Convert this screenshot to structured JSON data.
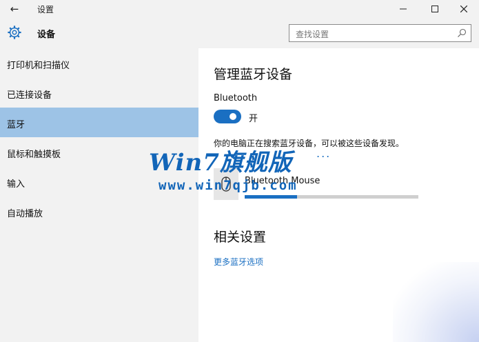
{
  "titlebar": {
    "title": "设置",
    "back_icon": "back-arrow-icon",
    "minimize_icon": "minimize-icon",
    "maximize_icon": "maximize-icon",
    "close_icon": "close-icon"
  },
  "header": {
    "icon": "gear-icon",
    "title": "设备",
    "search_placeholder": "查找设置",
    "search_icon": "search-icon"
  },
  "sidebar": {
    "items": [
      {
        "label": "打印机和扫描仪",
        "selected": false
      },
      {
        "label": "已连接设备",
        "selected": false
      },
      {
        "label": "蓝牙",
        "selected": true
      },
      {
        "label": "鼠标和触摸板",
        "selected": false
      },
      {
        "label": "输入",
        "selected": false
      },
      {
        "label": "自动播放",
        "selected": false
      }
    ]
  },
  "main": {
    "title": "管理蓝牙设备",
    "bluetooth_label": "Bluetooth",
    "toggle_state": "开",
    "toggle_on": true,
    "search_status": "你的电脑正在搜索蓝牙设备，可以被这些设备发现。",
    "searching_indicator": "...",
    "device": {
      "name": "Bluetooth Mouse",
      "icon": "mouse-icon",
      "progress_fraction": 0.3
    },
    "related_title": "相关设置",
    "more_link": "更多蓝牙选项"
  },
  "watermark": {
    "main": "Win7旗舰版",
    "sub": "www.win7qjb.com"
  },
  "colors": {
    "accent": "#1a6fc2",
    "selected_bg": "#9dc3e6",
    "sidebar_bg": "#f2f2f2"
  }
}
